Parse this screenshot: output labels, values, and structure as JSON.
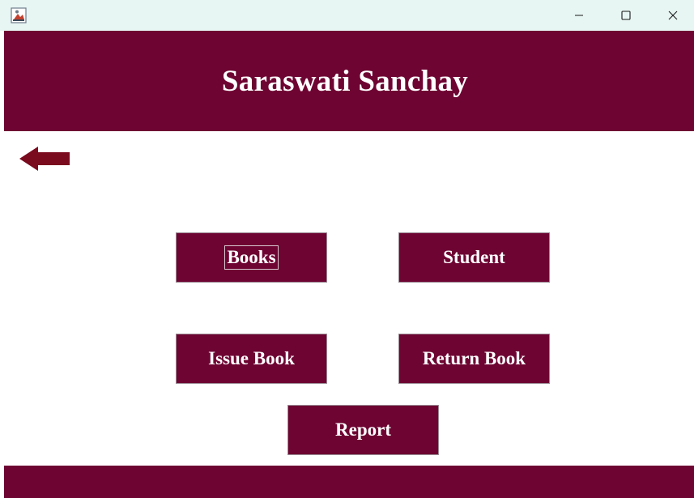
{
  "window": {
    "icons": {
      "app": "java-cup-icon",
      "minimize": "minimize-icon",
      "maximize": "maximize-icon",
      "close": "close-icon"
    }
  },
  "header": {
    "title": "Saraswati Sanchay"
  },
  "navigation": {
    "back_icon": "back-arrow-icon"
  },
  "menu": {
    "books_label": "Books",
    "student_label": "Student",
    "issue_book_label": "Issue Book",
    "return_book_label": "Return Book",
    "report_label": "Report"
  },
  "colors": {
    "brand": "#6e0432",
    "arrow": "#7a0a1e",
    "titlebar": "#e7f5f3",
    "text_on_brand": "#ffffff"
  }
}
